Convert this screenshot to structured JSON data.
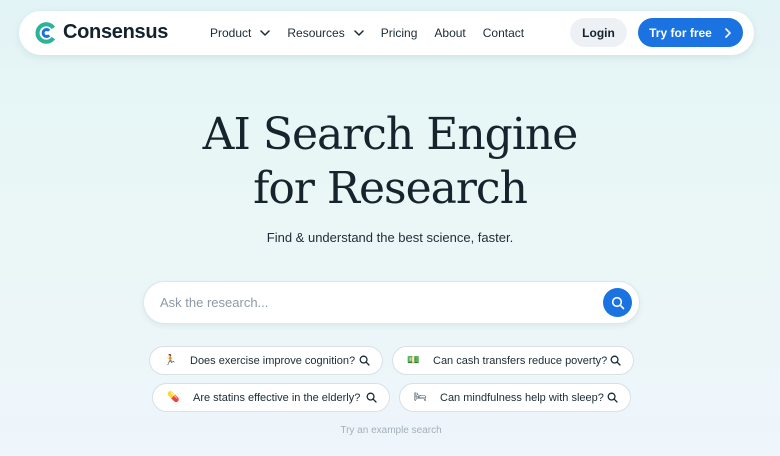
{
  "brand": {
    "name": "Consensus",
    "logo_icon": "consensus-logo-icon",
    "accent": "#1a73e0"
  },
  "nav": {
    "items": [
      {
        "label": "Product",
        "dropdown": true
      },
      {
        "label": "Resources",
        "dropdown": true
      },
      {
        "label": "Pricing",
        "dropdown": false
      },
      {
        "label": "About",
        "dropdown": false
      },
      {
        "label": "Contact",
        "dropdown": false
      }
    ],
    "login_label": "Login",
    "try_label": "Try for free"
  },
  "hero": {
    "title_line1": "AI Search Engine",
    "title_line2": "for Research",
    "subtitle": "Find & understand the best science, faster."
  },
  "search": {
    "placeholder": "Ask the research...",
    "value": ""
  },
  "examples": [
    {
      "emoji": "🏃",
      "icon": "running-person-icon",
      "label": "Does exercise improve cognition?"
    },
    {
      "emoji": "💵",
      "icon": "money-icon",
      "label": "Can cash transfers reduce poverty?"
    },
    {
      "emoji": "💊",
      "icon": "pill-icon",
      "label": "Are statins effective in the elderly?"
    },
    {
      "emoji": "🛏",
      "icon": "bed-icon",
      "label": "Can mindfulness help with sleep?"
    }
  ],
  "hint": "Try an example search"
}
